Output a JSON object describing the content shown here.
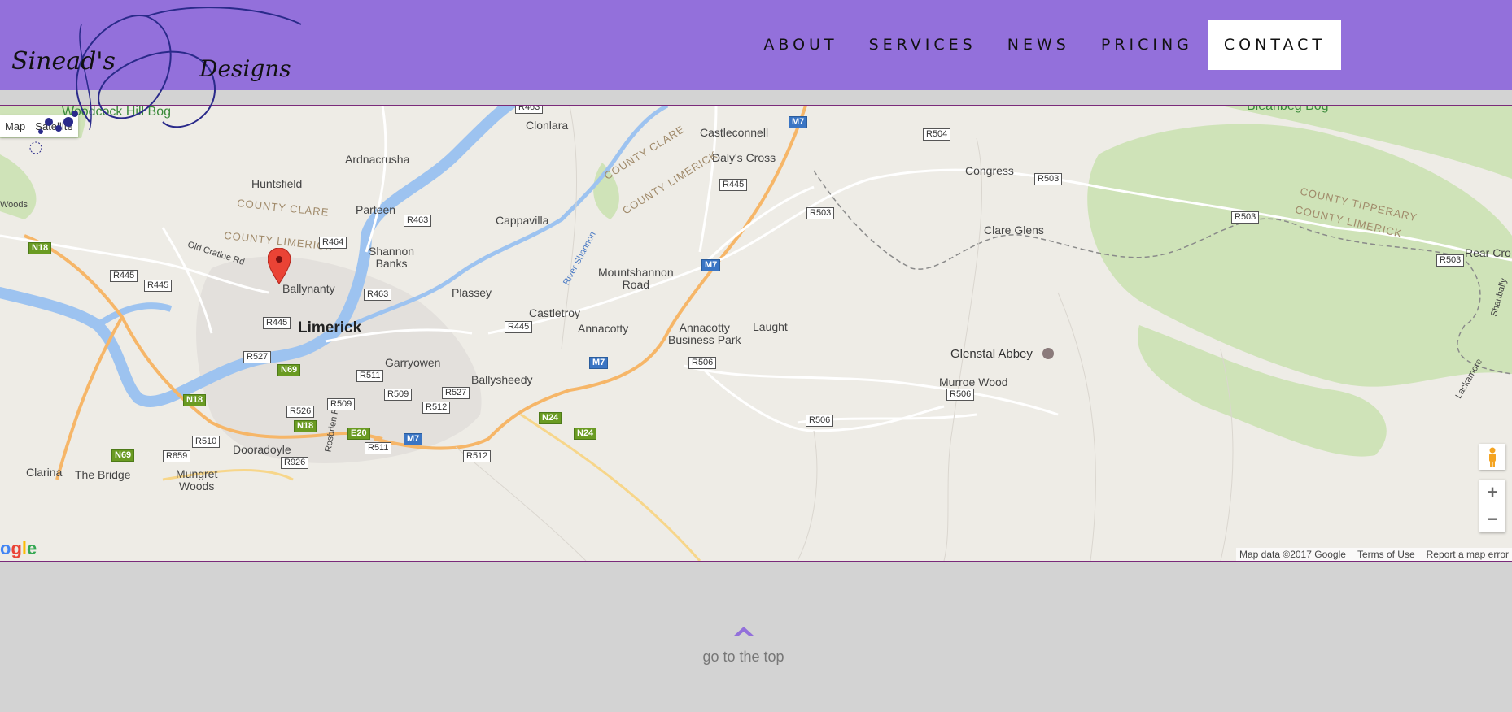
{
  "brand": {
    "name_left": "Sinead's",
    "name_right": "Designs"
  },
  "nav": {
    "items": [
      {
        "label": "ABOUT"
      },
      {
        "label": "SERVICES"
      },
      {
        "label": "NEWS"
      },
      {
        "label": "PRICING"
      },
      {
        "label": "CONTACT"
      }
    ],
    "active": "CONTACT"
  },
  "map": {
    "type_buttons": [
      "Map",
      "Satellite"
    ],
    "places": {
      "limerick": "Limerick",
      "ballynanty": "Ballynanty",
      "garryowen": "Garryowen",
      "ballysheedy": "Ballysheedy",
      "castletroy": "Castletroy",
      "annacotty": "Annacotty",
      "plassey": "Plassey",
      "mountshannon": "Mountshannon\nRoad",
      "shannon_banks": "Shannon\nBanks",
      "parteen": "Parteen",
      "cappavilla": "Cappavilla",
      "ardnacrusha": "Ardnacrusha",
      "huntsfield": "Huntsfield",
      "clonlara": "Clonlara",
      "castleconnell": "Castleconnell",
      "dalys_cross": "Daly's Cross",
      "congress": "Congress",
      "clare_glens": "Clare Glens",
      "laught": "Laught",
      "annacotty_bp": "Annacotty\nBusiness Park",
      "glenstal": "Glenstal Abbey",
      "murroe": "Murroe Wood",
      "dooradoyle": "Dooradoyle",
      "mungret": "Mungret\nWoods",
      "the_bridge": "The Bridge",
      "clarina": "Clarina",
      "rear_cross": "Rear Cro",
      "woodcock": "Woodcock\nHill Bog",
      "bleanbeg": "Bleanbeg Bog",
      "woods": "Woods",
      "river_shannon": "River Shannon",
      "old_cratloe": "Old Cratloe Rd",
      "rosbrien": "Rosbrien Rd",
      "shanbally": "Shanbally",
      "lackamore": "Lackamore"
    },
    "counties": {
      "clare1": "COUNTY CLARE",
      "limerick1": "COUNTY LIMERICK",
      "clare2": "COUNTY CLARE",
      "limerick2": "COUNTY LIMERICK",
      "tipperary": "COUNTY TIPPERARY",
      "limerick3": "COUNTY LIMERICK"
    },
    "road_labels": {
      "r463a": "R463",
      "r464": "R464",
      "r463b": "R463",
      "r445a": "R445",
      "r445b": "R445",
      "r445c": "R445",
      "r445d": "R445",
      "r445e": "R445",
      "r527a": "R527",
      "r511a": "R511",
      "r509a": "R509",
      "r527b": "R527",
      "r512a": "R512",
      "r526": "R526",
      "r509b": "R509",
      "r510": "R510",
      "r859": "R859",
      "r926": "R926",
      "r511b": "R511",
      "r512b": "R512",
      "r506a": "R506",
      "r506b": "R506",
      "r506c": "R506",
      "r504": "R504",
      "r503a": "R503",
      "r503b": "R503",
      "r503c": "R503",
      "r503d": "R503",
      "r445f": "R445",
      "n18a": "N18",
      "n18b": "N18",
      "n18c": "N18",
      "n69a": "N69",
      "n69b": "N69",
      "n24a": "N24",
      "n24b": "N24",
      "e20": "E20",
      "m7a": "M7",
      "m7b": "M7",
      "m7c": "M7",
      "m7d": "M7"
    },
    "attribution": "Map data ©2017 Google",
    "terms": "Terms of Use",
    "report": "Report a map error",
    "logo": "Google"
  },
  "footer": {
    "back_to_top": "go to the top"
  },
  "colors": {
    "header": "#9370db",
    "page": "#d3d3d3",
    "accent": "#9370db"
  }
}
